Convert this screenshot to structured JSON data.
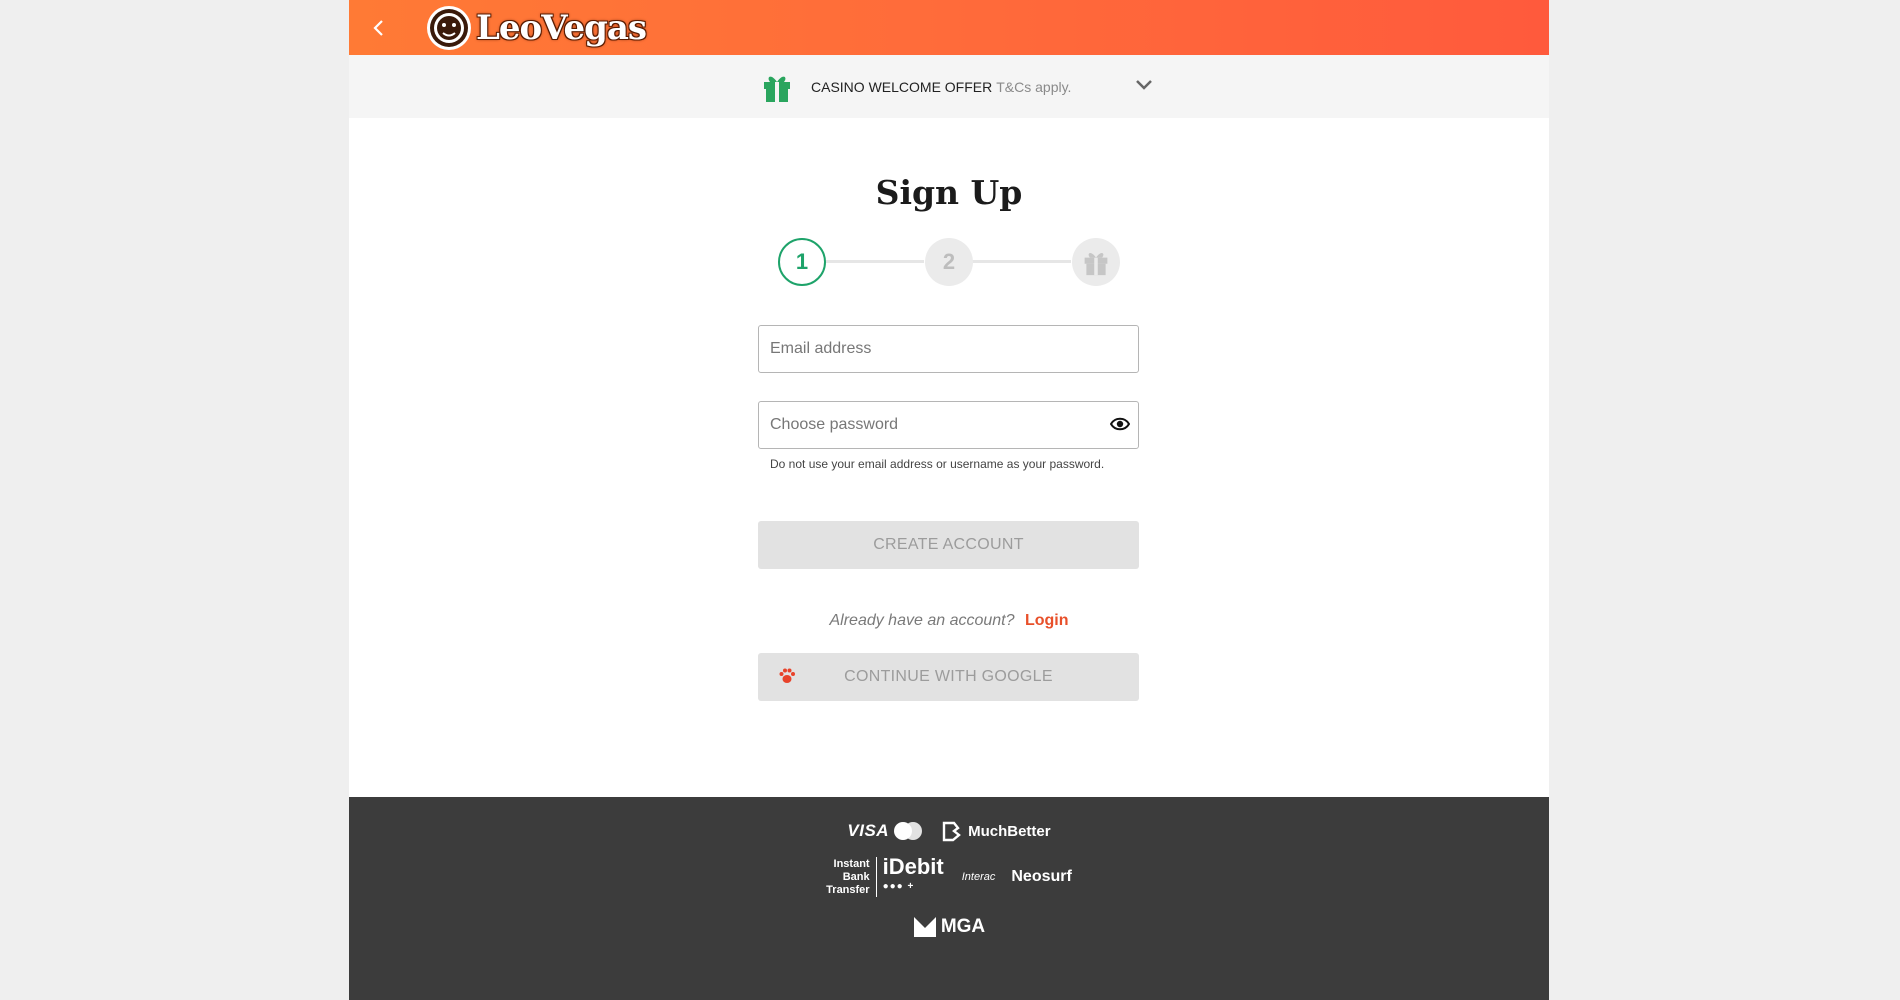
{
  "header": {
    "back_icon": "chevron-left-icon",
    "logo_text": "LeoVegas"
  },
  "offer": {
    "title": "CASINO WELCOME OFFER",
    "terms": "T&Cs apply.",
    "icon": "gift-icon",
    "accent_color": "#2aa55e"
  },
  "signup": {
    "title": "Sign Up",
    "steps": [
      {
        "label": "1",
        "state": "active"
      },
      {
        "label": "2",
        "state": "inactive"
      },
      {
        "label": "",
        "state": "inactive",
        "icon": "gift-icon"
      }
    ],
    "email_placeholder": "Email address",
    "password_placeholder": "Choose password",
    "password_hint": "Do not use your email address or username as your password.",
    "create_account_label": "CREATE ACCOUNT",
    "already_have_account": "Already have an account?",
    "login_label": "Login",
    "google_label": "CONTINUE WITH GOOGLE"
  },
  "footer": {
    "payments_row1": [
      "VISA",
      "MuchBetter"
    ],
    "payments_row2_ibt": "Instant Bank Transfer",
    "ibt_lines": [
      "Instant",
      "Bank",
      "Transfer"
    ],
    "idebit": "iDebit",
    "interac": "Interac",
    "neosurf": "Neosurf",
    "regulator": "MGA"
  },
  "colors": {
    "header_gradient_start": "#ff7a35",
    "header_gradient_end": "#ff5a3c",
    "step_active": "#1ea36a",
    "login_link": "#e8502a",
    "footer_bg": "#3c3c3c"
  }
}
